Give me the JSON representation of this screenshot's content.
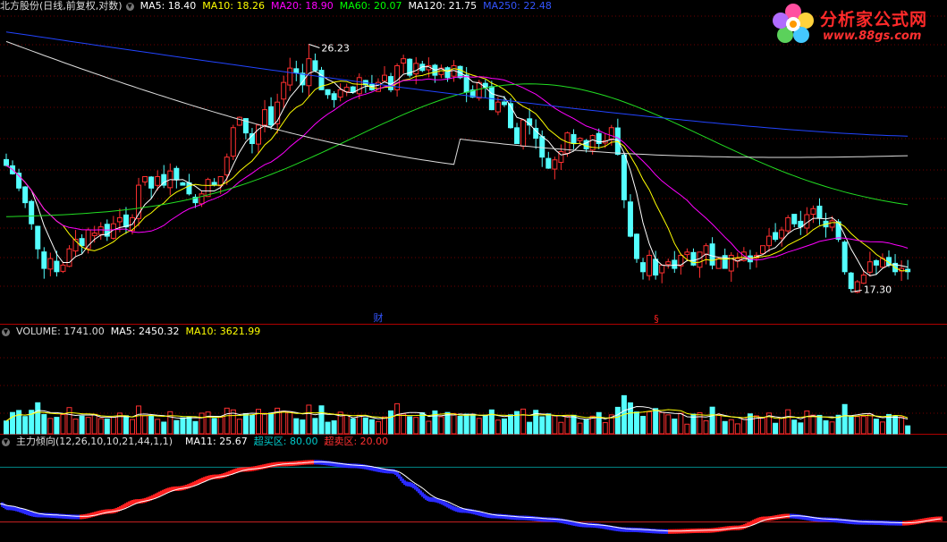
{
  "legend": {
    "main": {
      "title": "北方股份(日线,前复权,对数)",
      "items": [
        {
          "label": "MA5: 18.40",
          "color": "#ffffff"
        },
        {
          "label": "MA10: 18.26",
          "color": "#ffff00"
        },
        {
          "label": "MA20: 18.90",
          "color": "#ff00ff"
        },
        {
          "label": "MA60: 20.07",
          "color": "#00ff00"
        },
        {
          "label": "MA120: 21.75",
          "color": "#ffffff"
        },
        {
          "label": "MA250: 22.48",
          "color": "#3355ff"
        }
      ]
    },
    "volume": {
      "title": "VOLUME: 1741.00",
      "items": [
        {
          "label": "MA5: 2450.32",
          "color": "#ffffff"
        },
        {
          "label": "MA10: 3621.99",
          "color": "#ffff00"
        }
      ]
    },
    "indicator": {
      "title": "主力倾向(12,26,10,10,21,44,1,1)",
      "items": [
        {
          "label": "MA11: 25.67",
          "color": "#ffffff"
        },
        {
          "label": "超买区: 80.00",
          "color": "#00cccc"
        },
        {
          "label": "超卖区: 20.00",
          "color": "#ff3030"
        }
      ]
    }
  },
  "annotations": {
    "high": "26.23",
    "low": "17.30",
    "marker_cai": "财",
    "marker_s": "§"
  },
  "logo": {
    "cn": "分析家公式网",
    "url": "www.88gs.com"
  },
  "colors": {
    "up": "#ff3030",
    "down": "#54ffff",
    "axis": "#b00000",
    "grid": "#700000",
    "ma250": "#2244ff"
  },
  "chart_data": [
    {
      "type": "candlestick",
      "title": "北方股份(日线,前复权,对数)",
      "scale": "log",
      "ylim": [
        16.5,
        27.5
      ],
      "extremes": {
        "high": 26.23,
        "low": 17.3
      },
      "moving_averages": [
        {
          "name": "MA5",
          "value": 18.4
        },
        {
          "name": "MA10",
          "value": 18.26
        },
        {
          "name": "MA20",
          "value": 18.9
        },
        {
          "name": "MA60",
          "value": 20.07
        },
        {
          "name": "MA120",
          "value": 21.75
        },
        {
          "name": "MA250",
          "value": 22.48
        }
      ],
      "closes": [
        21.4,
        21.1,
        20.6,
        20.1,
        19.4,
        18.6,
        18.0,
        18.3,
        17.9,
        18.1,
        18.6,
        18.9,
        18.7,
        19.2,
        19.1,
        19.3,
        19.0,
        19.4,
        19.6,
        19.3,
        19.6,
        20.7,
        21.0,
        20.6,
        21.0,
        20.7,
        21.2,
        20.9,
        20.7,
        20.4,
        20.1,
        20.4,
        20.9,
        20.7,
        21.0,
        21.7,
        22.8,
        23.2,
        22.6,
        22.2,
        22.9,
        23.5,
        22.9,
        23.8,
        24.6,
        25.2,
        25.0,
        24.5,
        25.6,
        25.1,
        24.3,
        24.1,
        23.9,
        24.3,
        24.4,
        24.2,
        24.8,
        24.5,
        24.3,
        24.6,
        24.9,
        24.3,
        25.3,
        25.6,
        24.9,
        25.4,
        25.1,
        25.3,
        24.9,
        25.2,
        24.8,
        25.3,
        24.8,
        24.2,
        24.0,
        24.6,
        24.4,
        23.5,
        23.8,
        23.7,
        22.8,
        22.2,
        23.1,
        22.9,
        22.4,
        21.7,
        21.3,
        21.6,
        21.9,
        22.6,
        22.2,
        22.4,
        22.0,
        22.5,
        22.2,
        22.3,
        22.8,
        21.8,
        20.2,
        19.0,
        18.3,
        17.9,
        18.4,
        17.8,
        18.1,
        18.2,
        18.0,
        18.4,
        18.5,
        18.1,
        18.5,
        18.7,
        18.1,
        18.3,
        18.0,
        18.4,
        18.3,
        18.5,
        18.2,
        18.4,
        18.7,
        19.0,
        18.9,
        19.2,
        19.6,
        19.4,
        19.3,
        19.7,
        19.9,
        19.6,
        19.3,
        19.5,
        18.9,
        17.9,
        17.4,
        17.6,
        17.8,
        18.2,
        18.1,
        18.3,
        18.1,
        17.9,
        18.0,
        17.9
      ]
    },
    {
      "type": "bar",
      "title": "VOLUME: 1741.00",
      "latest": 1741.0,
      "moving_averages": [
        {
          "name": "MA5",
          "value": 2450.32
        },
        {
          "name": "MA10",
          "value": 3621.99
        }
      ],
      "ylim": [
        0,
        21000
      ]
    },
    {
      "type": "line",
      "title": "主力倾向(12,26,10,10,21,44,1,1)",
      "ylim": [
        0,
        100
      ],
      "levels": [
        {
          "name": "超买区",
          "value": 80.0
        },
        {
          "name": "超卖区",
          "value": 20.0
        }
      ],
      "ma11_latest": 25.67,
      "keypoints": [
        [
          0,
          40
        ],
        [
          2,
          36
        ],
        [
          10,
          28
        ],
        [
          20,
          26
        ],
        [
          28,
          32
        ],
        [
          35,
          43
        ],
        [
          45,
          57
        ],
        [
          55,
          70
        ],
        [
          62,
          78
        ],
        [
          72,
          84
        ],
        [
          80,
          86
        ],
        [
          90,
          82
        ],
        [
          100,
          76
        ],
        [
          104,
          62
        ],
        [
          110,
          45
        ],
        [
          118,
          33
        ],
        [
          126,
          27
        ],
        [
          133,
          25
        ],
        [
          140,
          23
        ],
        [
          150,
          17
        ],
        [
          160,
          12
        ],
        [
          170,
          10
        ],
        [
          180,
          11
        ],
        [
          188,
          14
        ],
        [
          195,
          24
        ],
        [
          201,
          27
        ],
        [
          210,
          23
        ],
        [
          220,
          20
        ],
        [
          230,
          19
        ],
        [
          240,
          24
        ]
      ]
    }
  ]
}
